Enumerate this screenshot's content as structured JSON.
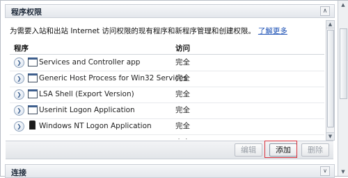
{
  "panel": {
    "title": "程序权限",
    "collapse_glyph": "∧"
  },
  "description": {
    "text": "为需要入站和出站 Internet 访问权限的现有程序和新程序管理和创建权限。",
    "link": "了解更多"
  },
  "table": {
    "columns": [
      "程序",
      "访问"
    ],
    "rows": [
      {
        "name": "Services and Controller app",
        "access": "完全",
        "icon": "window-icon"
      },
      {
        "name": "Generic Host Process for Win32 Services",
        "access": "完全",
        "icon": "window-icon"
      },
      {
        "name": "LSA Shell (Export Version)",
        "access": "完全",
        "icon": "window-icon"
      },
      {
        "name": "Userinit Logon Application",
        "access": "完全",
        "icon": "window-icon"
      },
      {
        "name": "Windows NT Logon Application",
        "access": "完全",
        "icon": "logon-app-icon"
      },
      {
        "name": "",
        "access": "完全",
        "icon": "window-icon"
      }
    ]
  },
  "buttons": {
    "edit": "编辑",
    "add": "添加",
    "remove": "删除"
  },
  "next_section": {
    "title": "连接",
    "chevron_glyph": "∨"
  },
  "colors": {
    "highlight": "#d9303a",
    "link": "#1a4fb4"
  }
}
